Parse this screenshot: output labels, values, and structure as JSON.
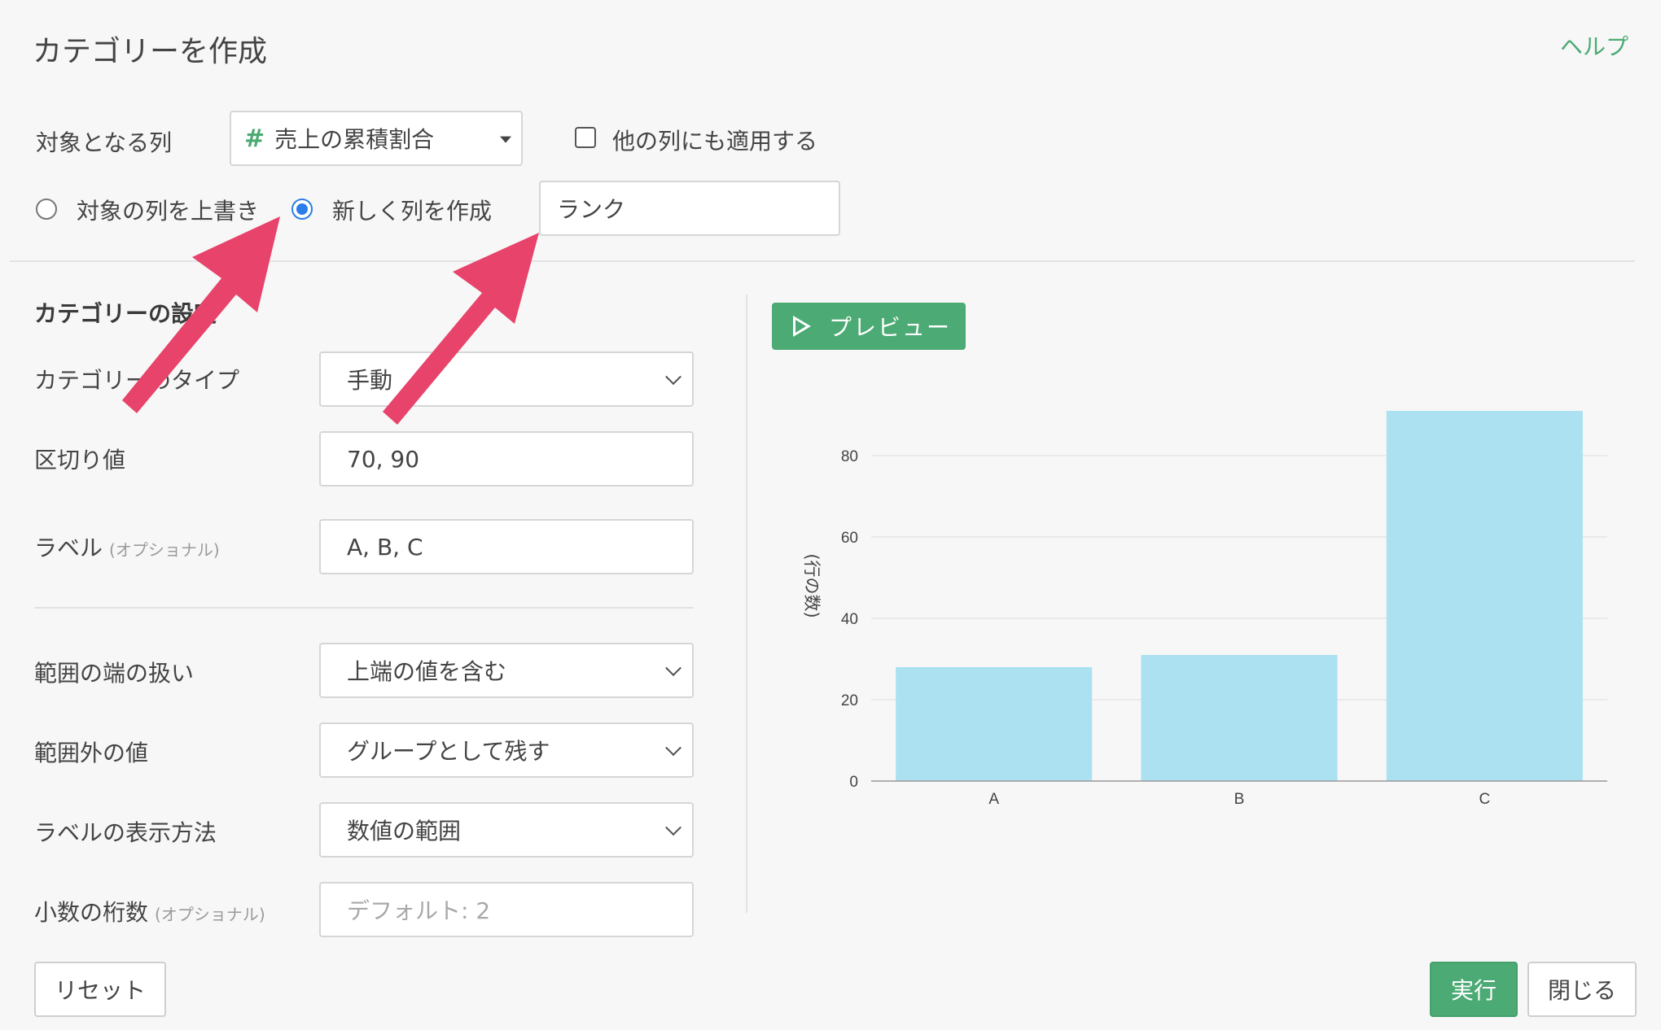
{
  "dialog": {
    "title": "カテゴリーを作成",
    "help_label": "ヘルプ"
  },
  "target": {
    "label": "対象となる列",
    "column_value": "売上の累積割合",
    "column_type_icon": "hash-icon",
    "apply_other_label": "他の列にも適用する",
    "overwrite_label": "対象の列を上書き",
    "new_column_label": "新しく列を作成",
    "new_column_name": "ランク"
  },
  "settings": {
    "heading": "カテゴリーの設定",
    "type_label": "カテゴリーのタイプ",
    "type_value": "手動",
    "breaks_label": "区切り値",
    "breaks_value": "70, 90",
    "labels_label": "ラベル",
    "optional_note": "(オプショナル)",
    "labels_value": "A, B, C",
    "edge_label": "範囲の端の扱い",
    "edge_value": "上端の値を含む",
    "outside_label": "範囲外の値",
    "outside_value": "グループとして残す",
    "display_label": "ラベルの表示方法",
    "display_value": "数値の範囲",
    "digits_label": "小数の桁数",
    "digits_placeholder": "デフォルト: 2"
  },
  "buttons": {
    "reset": "リセット",
    "run": "実行",
    "close": "閉じる",
    "preview": "プレビュー"
  },
  "colors": {
    "accent": "#4caa74",
    "bar": "#abe1f1",
    "arrow": "#e8436b",
    "radio": "#2b7de9"
  },
  "chart_data": {
    "type": "bar",
    "categories": [
      "A",
      "B",
      "C"
    ],
    "values": [
      28,
      31,
      91
    ],
    "ylabel": "(行の数)",
    "ylim": [
      0,
      96
    ],
    "yticks": [
      0,
      20,
      40,
      60,
      80
    ],
    "grid": true
  }
}
